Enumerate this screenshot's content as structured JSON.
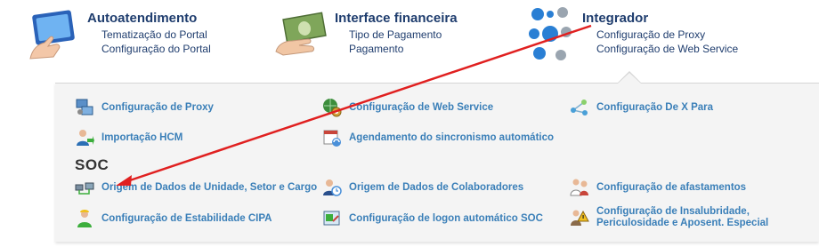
{
  "top_menu": {
    "col1": {
      "title": "Autoatendimento",
      "items": [
        "Tematização do Portal",
        "Configuração do Portal"
      ],
      "icon": "touchscreen-icon"
    },
    "col2": {
      "title": "Interface financeira",
      "items": [
        "Tipo de Pagamento",
        "Pagamento"
      ],
      "icon": "money-icon"
    },
    "col3": {
      "title": "Integrador",
      "items": [
        "Configuração de Proxy",
        "Configuração de Web Service"
      ],
      "icon": "integrator-icon"
    }
  },
  "panel": {
    "row1": [
      "Configuração de Proxy",
      "Configuração de Web Service",
      "Configuração De X Para"
    ],
    "row2": [
      "Importação HCM",
      "Agendamento do sincronismo automático"
    ],
    "soc_heading": "SOC",
    "row3": [
      "Origem de Dados de Unidade, Setor e Cargo",
      "Origem de Dados de Colaboradores",
      "Configuração de afastamentos"
    ],
    "row4": [
      "Configuração de Estabilidade CIPA",
      "Configuração de logon automático SOC"
    ],
    "row4_col3_line1": "Configuração de Insalubridade,",
    "row4_col3_line2": "Periculosidade e Aposent. Especial"
  },
  "colors": {
    "title": "#1f3d6e",
    "link": "#3a7fb8",
    "arrow": "#e02020"
  }
}
